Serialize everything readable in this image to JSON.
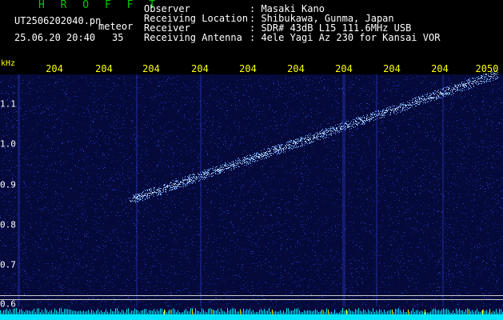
{
  "header": {
    "title": "H R O F F T",
    "filename": "UT2506202040.pn",
    "filename_sub": "meteor",
    "datetime": "25.06.20 20:40",
    "count": "35",
    "info": [
      {
        "label": "Observer",
        "value": ": Masaki Kano"
      },
      {
        "label": "Receiving Location",
        "value": ": Shibukawa, Gunma, Japan"
      },
      {
        "label": "Receiver",
        "value": ": SDR# 43dB L15 111.6MHz USB"
      },
      {
        "label": "Receiving Antenna",
        "value": ": 4ele Yagi Az 230 for Kansai VOR"
      }
    ]
  },
  "axis": {
    "y_unit": "kHz",
    "y_ticks": [
      "1.1",
      "1.0",
      "0.9",
      "0.8",
      "0.7",
      "0.6"
    ],
    "time_ticks": [
      "204",
      "204",
      "204",
      "204",
      "204",
      "204",
      "204",
      "204",
      "204",
      "2050"
    ]
  },
  "colors": {
    "header_title": "#00c800",
    "header_text": "#ffffff",
    "tick_text": "#ffff00",
    "noise": "#1e2ab4",
    "trail": "#7ab4ff",
    "baseline": "#00e6ff"
  }
}
